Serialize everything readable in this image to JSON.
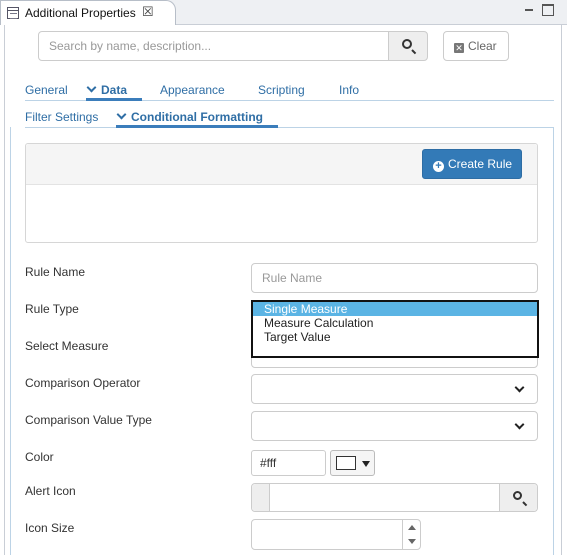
{
  "window": {
    "tab_title": "Additional Properties"
  },
  "search": {
    "placeholder": "Search by name, description...",
    "clear_label": "Clear"
  },
  "tabs": [
    {
      "label": "General"
    },
    {
      "label": "Data",
      "active": true
    },
    {
      "label": "Appearance"
    },
    {
      "label": "Scripting"
    },
    {
      "label": "Info"
    }
  ],
  "subtabs": [
    {
      "label": "Filter Settings"
    },
    {
      "label": "Conditional Formatting",
      "active": true
    }
  ],
  "rules": {
    "create_label": "Create Rule"
  },
  "form": {
    "rule_name_label": "Rule Name",
    "rule_name_placeholder": "Rule Name",
    "rule_type_label": "Rule Type",
    "rule_type_options": [
      "Single Measure",
      "Measure Calculation",
      "Target Value"
    ],
    "rule_type_selected": "Single Measure",
    "select_measure_label": "Select Measure",
    "comparison_operator_label": "Comparison Operator",
    "comparison_value_type_label": "Comparison Value Type",
    "color_label": "Color",
    "color_value": "#fff",
    "alert_icon_label": "Alert Icon",
    "icon_size_label": "Icon Size"
  },
  "colors": {
    "accent": "#337ab7",
    "tab_text": "#2f6ea5",
    "dropdown_highlight": "#5bb4e4"
  }
}
